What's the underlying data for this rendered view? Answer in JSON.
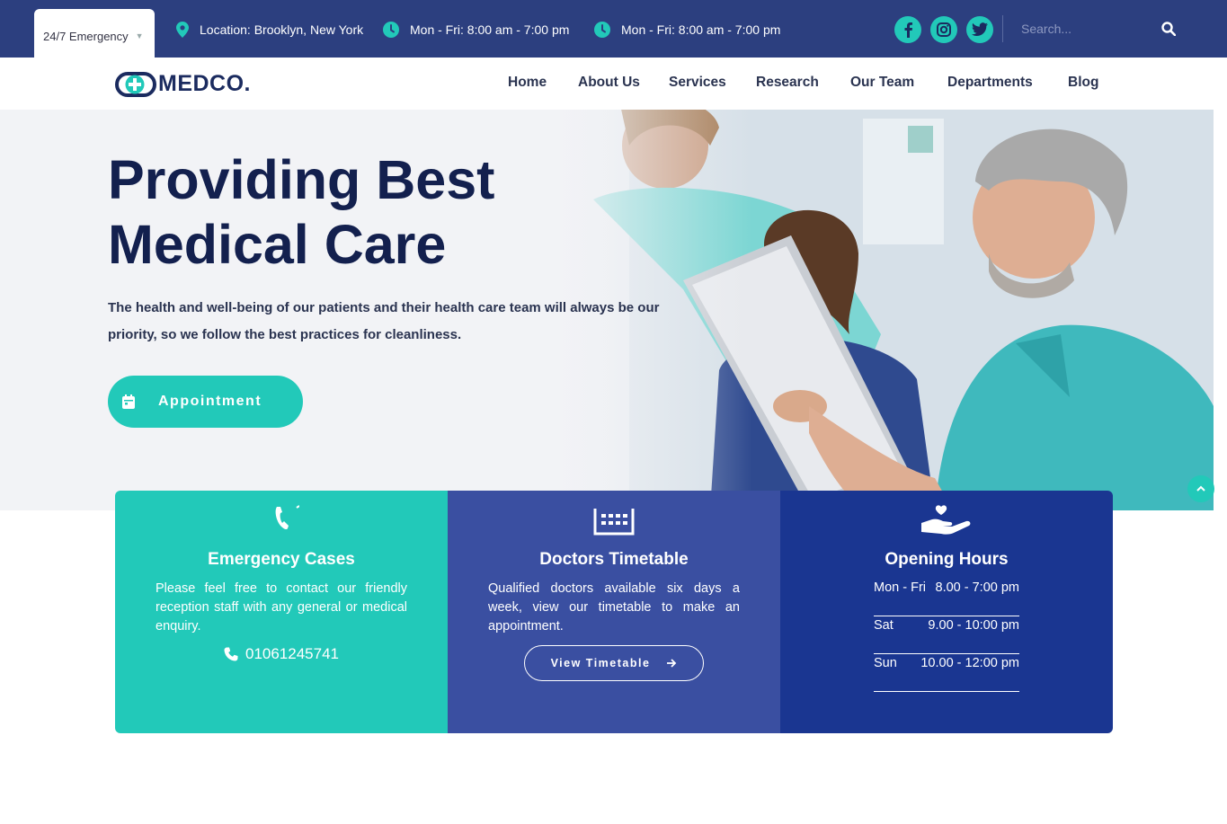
{
  "topbar": {
    "emergency_label": "24/7 Emergency",
    "location": "Location: Brooklyn, New York",
    "hours_1": "Mon - Fri: 8:00 am - 7:00 pm",
    "hours_2": "Mon - Fri: 8:00 am - 7:00 pm",
    "social": [
      "facebook-icon",
      "instagram-icon",
      "twitter-icon"
    ],
    "search_placeholder": "Search...",
    "bg_color": "#2c3f7f",
    "accent_color": "#22c9b9"
  },
  "nav": {
    "logo_text": "MEDCO.",
    "items": [
      "Home",
      "About Us",
      "Services",
      "Research",
      "Our Team",
      "Departments",
      "Blog"
    ]
  },
  "hero": {
    "title_line1": "Providing Best",
    "title_line2": "Medical Care",
    "description": "The health and well-being of our patients and their health care team will always be our priority, so we follow the best practices for cleanliness.",
    "button_label": "Appointment"
  },
  "cards": {
    "emergency": {
      "title": "Emergency Cases",
      "text": "Please feel free to contact our friendly reception staff with any general or medical enquiry.",
      "phone": "01061245741",
      "color": "#22c9b9"
    },
    "timetable": {
      "title": "Doctors Timetable",
      "text": "Qualified doctors available six days a week, view our timetable to make an appointment.",
      "button_label": "View Timetable",
      "color": "#3a4fa1"
    },
    "hours": {
      "title": "Opening Hours",
      "rows": [
        {
          "day": "Mon - Fri",
          "time": "8.00 - 7:00 pm"
        },
        {
          "day": "Sat",
          "time": "9.00 - 10:00 pm"
        },
        {
          "day": "Sun",
          "time": "10.00 - 12:00 pm"
        }
      ],
      "color": "#1a3691"
    }
  }
}
